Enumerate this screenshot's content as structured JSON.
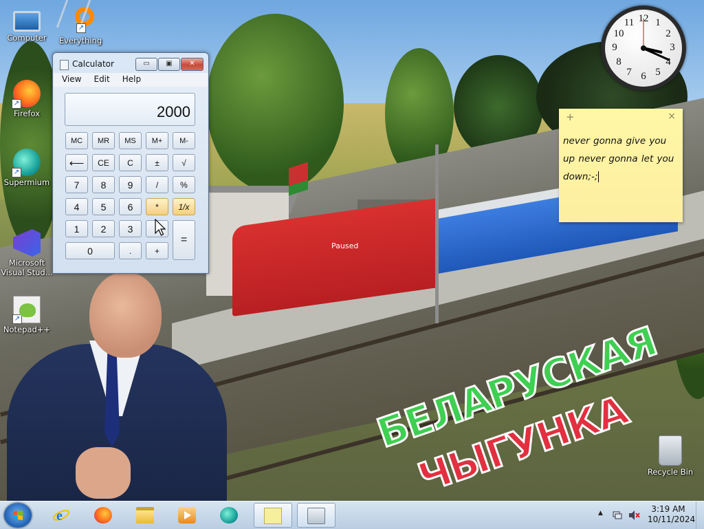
{
  "desktop": {
    "icons": [
      {
        "label": "Computer"
      },
      {
        "label": "Everything"
      },
      {
        "label": "Firefox"
      },
      {
        "label": "Supermium"
      },
      {
        "label": "Microsoft Visual Stud..."
      },
      {
        "label": "Notepad++"
      },
      {
        "label": "Recycle Bin"
      }
    ]
  },
  "wallpaper": {
    "loco_status": "Paused",
    "logo_line1": "БЕЛАРУСКАЯ",
    "logo_line2": "ЧЫГУНКА"
  },
  "clock_gadget": {
    "numbers": [
      "12",
      "1",
      "2",
      "3",
      "4",
      "5",
      "6",
      "7",
      "8",
      "9",
      "10",
      "11"
    ]
  },
  "sticky_note": {
    "add_symbol": "+",
    "close_symbol": "×",
    "text": "never gonna give you up never gonna let you down;-;"
  },
  "calculator": {
    "title": "Calculator",
    "menu": [
      "View",
      "Edit",
      "Help"
    ],
    "display": "2000",
    "window_buttons": {
      "minimize": "▭",
      "maximize": "▣",
      "close": "✕"
    },
    "buttons": {
      "mc": "MC",
      "mr": "MR",
      "ms": "MS",
      "mplus": "M+",
      "mminus": "M-",
      "back": "⟵",
      "ce": "CE",
      "c": "C",
      "plusminus": "±",
      "sqrt": "√",
      "n7": "7",
      "n8": "8",
      "n9": "9",
      "div": "/",
      "pct": "%",
      "n4": "4",
      "n5": "5",
      "n6": "6",
      "mul": "*",
      "recip": "1/x",
      "n1": "1",
      "n2": "2",
      "n3": "3",
      "sub": "-",
      "eq": "=",
      "n0": "0",
      "dot": ".",
      "add": "+"
    }
  },
  "taskbar": {
    "time": "3:19 AM",
    "date": "10/11/2024",
    "tray_arrow": "▲"
  }
}
